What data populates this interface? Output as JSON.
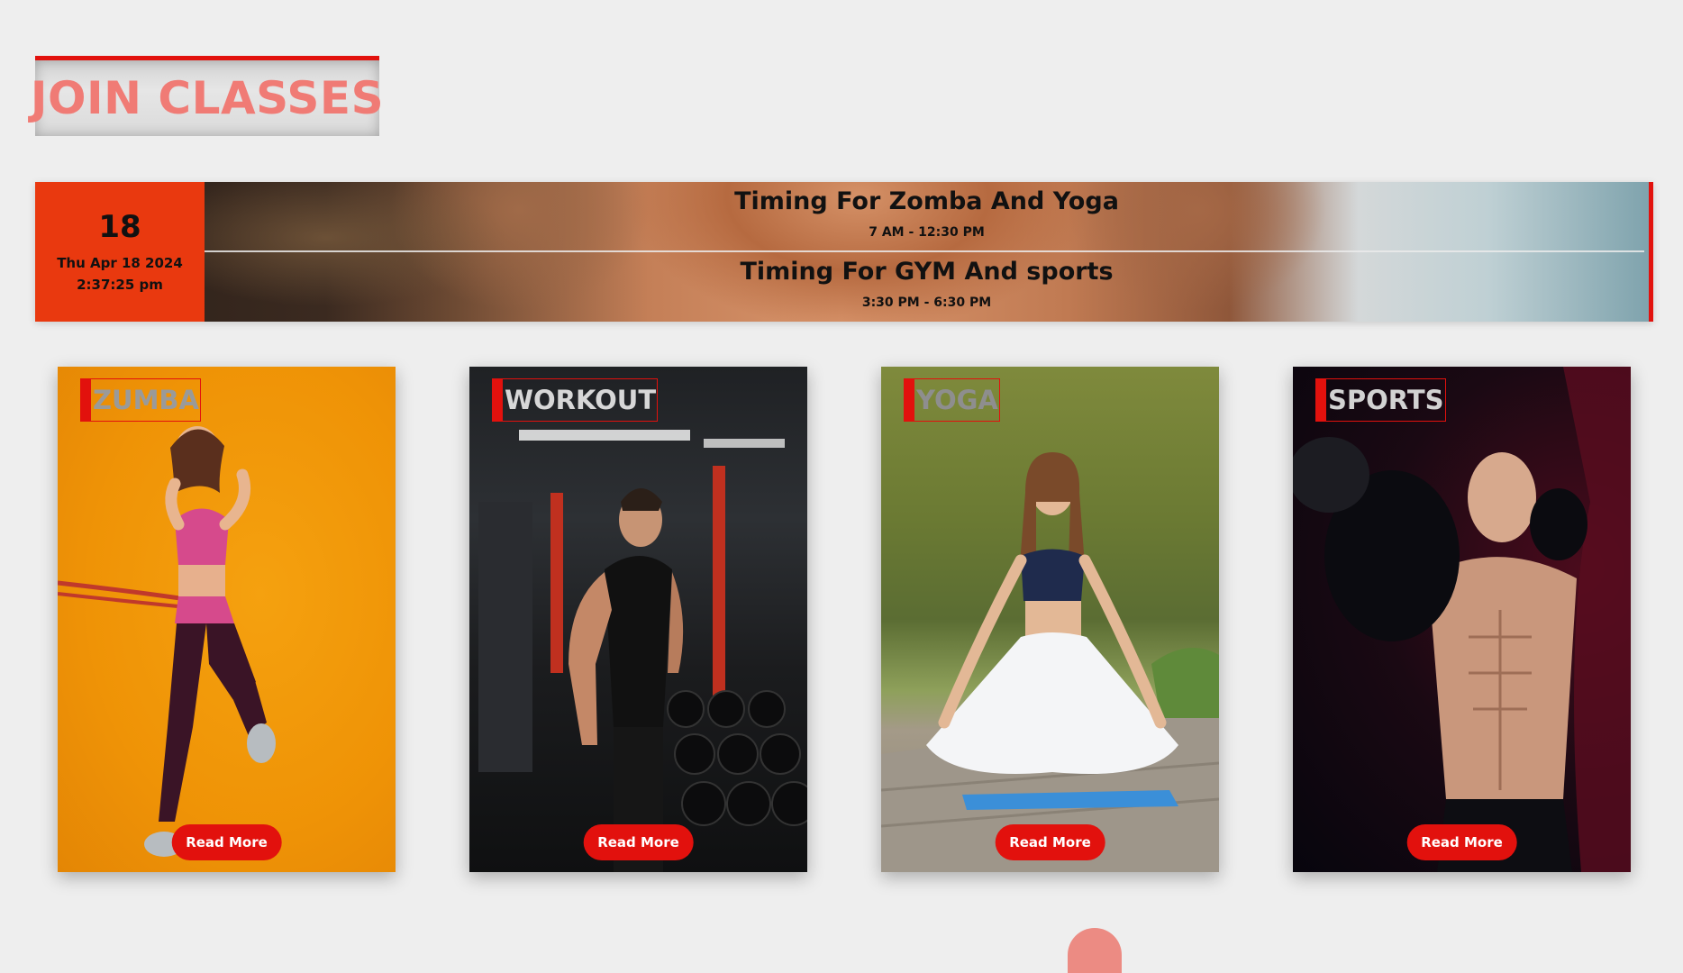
{
  "section_title": "JOIN CLASSES",
  "timing_banner": {
    "date": {
      "day": "18",
      "full_date": "Thu Apr 18 2024",
      "time": "2:37:25 pm"
    },
    "schedules": [
      {
        "title": "Timing For Zomba And Yoga",
        "hours": "7 AM - 12:30 PM"
      },
      {
        "title": "Timing For GYM And sports",
        "hours": "3:30 PM - 6:30 PM"
      }
    ]
  },
  "classes": [
    {
      "name": "ZUMBA",
      "button": "Read More",
      "image": "zumba-woman-photo"
    },
    {
      "name": "WORKOUT",
      "button": "Read More",
      "image": "gym-workout-photo"
    },
    {
      "name": "YOGA",
      "button": "Read More",
      "image": "yoga-meditation-photo"
    },
    {
      "name": "SPORTS",
      "button": "Read More",
      "image": "boxer-photo"
    }
  ],
  "colors": {
    "accent": "#e2110d",
    "date_block": "#e9390f",
    "title_text": "#f07b75",
    "page_bg": "#eeeeee"
  }
}
